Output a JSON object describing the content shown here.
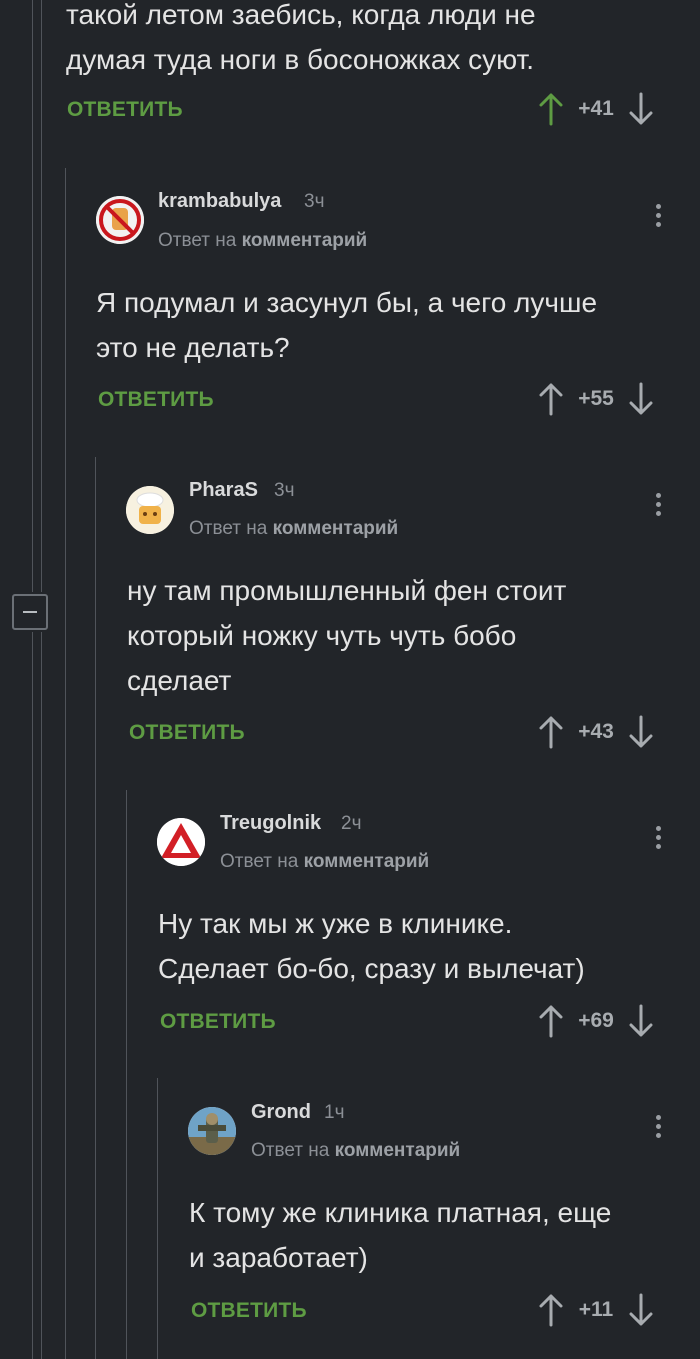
{
  "top_comment": {
    "body_lines": [
      "такой летом заебись, когда люди не",
      "думая туда ноги в босоножках суют."
    ],
    "reply_label": "ОТВЕТИТЬ",
    "score": "+41"
  },
  "comments": [
    {
      "author": "krambabulya",
      "time": "3ч",
      "reply_prefix": "Ответ на",
      "reply_target": "комментарий",
      "body_lines": [
        "Я подумал и засунул бы, а чего лучше",
        "это не делать?"
      ],
      "reply_label": "ОТВЕТИТЬ",
      "score": "+55"
    },
    {
      "author": "PharaS",
      "time": "3ч",
      "reply_prefix": "Ответ на",
      "reply_target": "комментарий",
      "body_lines": [
        "ну там промышленный фен стоит",
        "который ножку чуть чуть бобо",
        "сделает"
      ],
      "reply_label": "ОТВЕТИТЬ",
      "score": "+43"
    },
    {
      "author": "Treugolnik",
      "time": "2ч",
      "reply_prefix": "Ответ на",
      "reply_target": "комментарий",
      "body_lines": [
        "Ну так мы ж уже в клинике.",
        "Сделает бо-бо, сразу и вылечат)"
      ],
      "reply_label": "ОТВЕТИТЬ",
      "score": "+69"
    },
    {
      "author": "Grond",
      "time": "1ч",
      "reply_prefix": "Ответ на",
      "reply_target": "комментарий",
      "body_lines": [
        "К тому же клиника платная, еще",
        "и заработает)"
      ],
      "reply_label": "ОТВЕТИТЬ",
      "score": "+11"
    }
  ],
  "colors": {
    "background": "#222529",
    "reply_green": "#5e9c43",
    "upvoted_green": "#5e9c43",
    "text": "#e4e4e4",
    "muted": "#8c9096"
  },
  "icons": {
    "upvote": "arrow-up-icon",
    "downvote": "arrow-down-icon",
    "menu": "kebab-menu-icon",
    "collapse": "minus-icon"
  }
}
